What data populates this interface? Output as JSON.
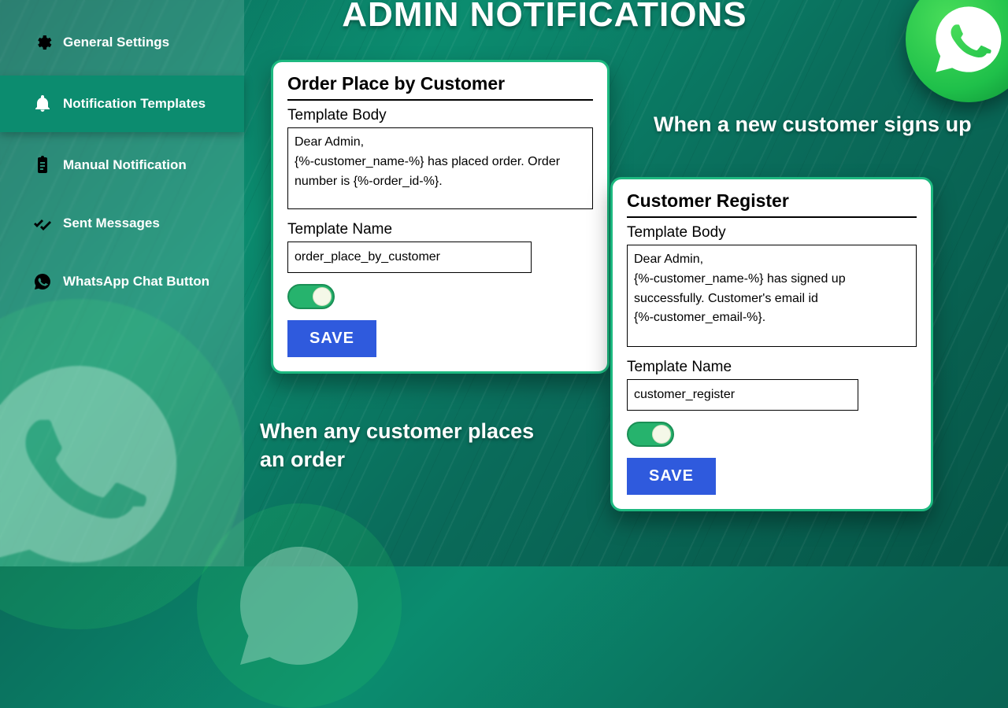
{
  "header": {
    "title": "ADMIN NOTIFICATIONS"
  },
  "sidebar": {
    "items": [
      {
        "label": "General Settings",
        "icon": "gear-icon"
      },
      {
        "label": "Notification Templates",
        "icon": "bell-icon"
      },
      {
        "label": "Manual Notification",
        "icon": "clipboard-icon"
      },
      {
        "label": "Sent Messages",
        "icon": "double-check-icon"
      },
      {
        "label": "WhatsApp Chat Button",
        "icon": "whatsapp-icon"
      }
    ],
    "active_index": 1
  },
  "captions": {
    "order_place": "When any customer places an order",
    "customer_register": "When a new customer signs up"
  },
  "cards": {
    "order_place": {
      "title": "Order Place by Customer",
      "body_label": "Template Body",
      "body_value": "Dear Admin,\n{%-customer_name-%} has placed order. Order number is {%-order_id-%}.",
      "name_label": "Template Name",
      "name_value": "order_place_by_customer",
      "enabled": true,
      "save_label": "SAVE"
    },
    "customer_register": {
      "title": "Customer Register",
      "body_label": "Template Body",
      "body_value": "Dear Admin,\n{%-customer_name-%} has signed up successfully. Customer's email id\n{%-customer_email-%}.",
      "name_label": "Template Name",
      "name_value": "customer_register",
      "enabled": true,
      "save_label": "SAVE"
    }
  },
  "colors": {
    "accent_green": "#1db980",
    "toggle_green": "#26b36d",
    "save_blue": "#2f5add"
  }
}
